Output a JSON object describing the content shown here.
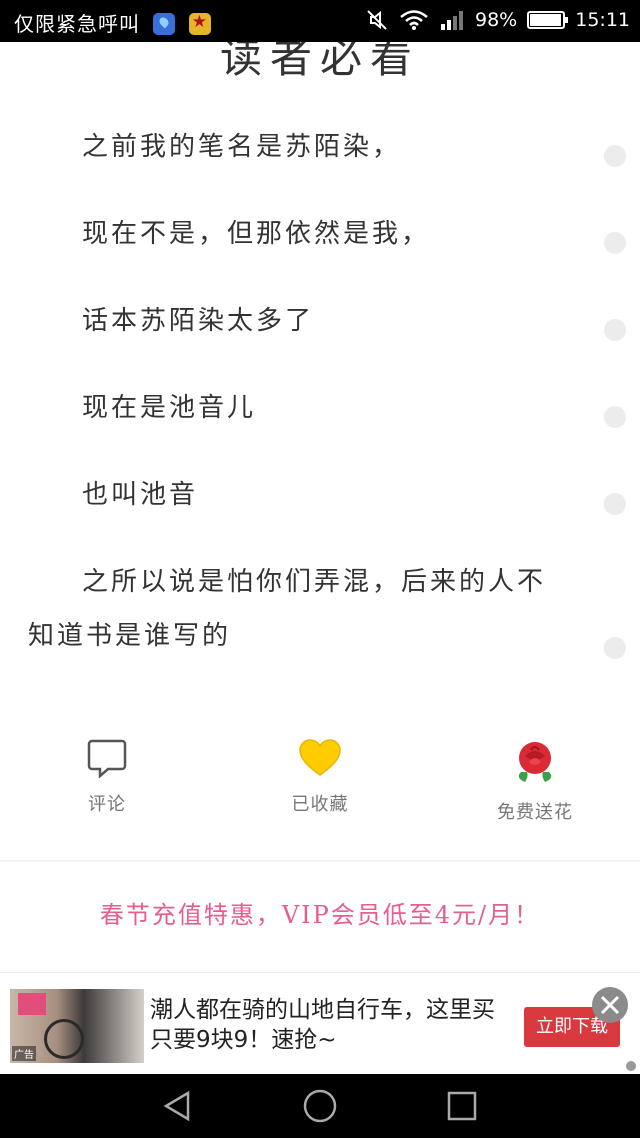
{
  "status_bar": {
    "carrier_text": "仅限紧急呼叫",
    "battery": "98%",
    "time": "15:11",
    "icons": [
      "map-pin-icon",
      "star-badge-icon",
      "mute-icon",
      "wifi-icon",
      "signal-icon",
      "battery-icon"
    ]
  },
  "chapter": {
    "title": "读者必看",
    "paragraphs": [
      "之前我的笔名是苏陌染，",
      "现在不是，但那依然是我，",
      "话本苏陌染太多了",
      "现在是池音儿",
      "也叫池音",
      "之所以说是怕你们弄混，后来的人不知道书是谁写的"
    ]
  },
  "actions": {
    "comment": {
      "label": "评论",
      "icon": "speech-bubble-icon"
    },
    "favorite": {
      "label": "已收藏",
      "icon": "heart-icon",
      "color": "#ffcc00"
    },
    "flower": {
      "label": "免费送花",
      "icon": "rose-icon",
      "color": "#d92a36"
    }
  },
  "promo": {
    "text": "春节充值特惠，VIP会员低至4元/月！",
    "color": "#e85d8f"
  },
  "ad": {
    "text": "潮人都在骑的山地自行车，这里买只要9块9！速抢~",
    "cta": "立即下载",
    "thumb_tag": "广告"
  },
  "nav": {
    "icons": [
      "back-icon",
      "home-icon",
      "recents-icon"
    ]
  }
}
